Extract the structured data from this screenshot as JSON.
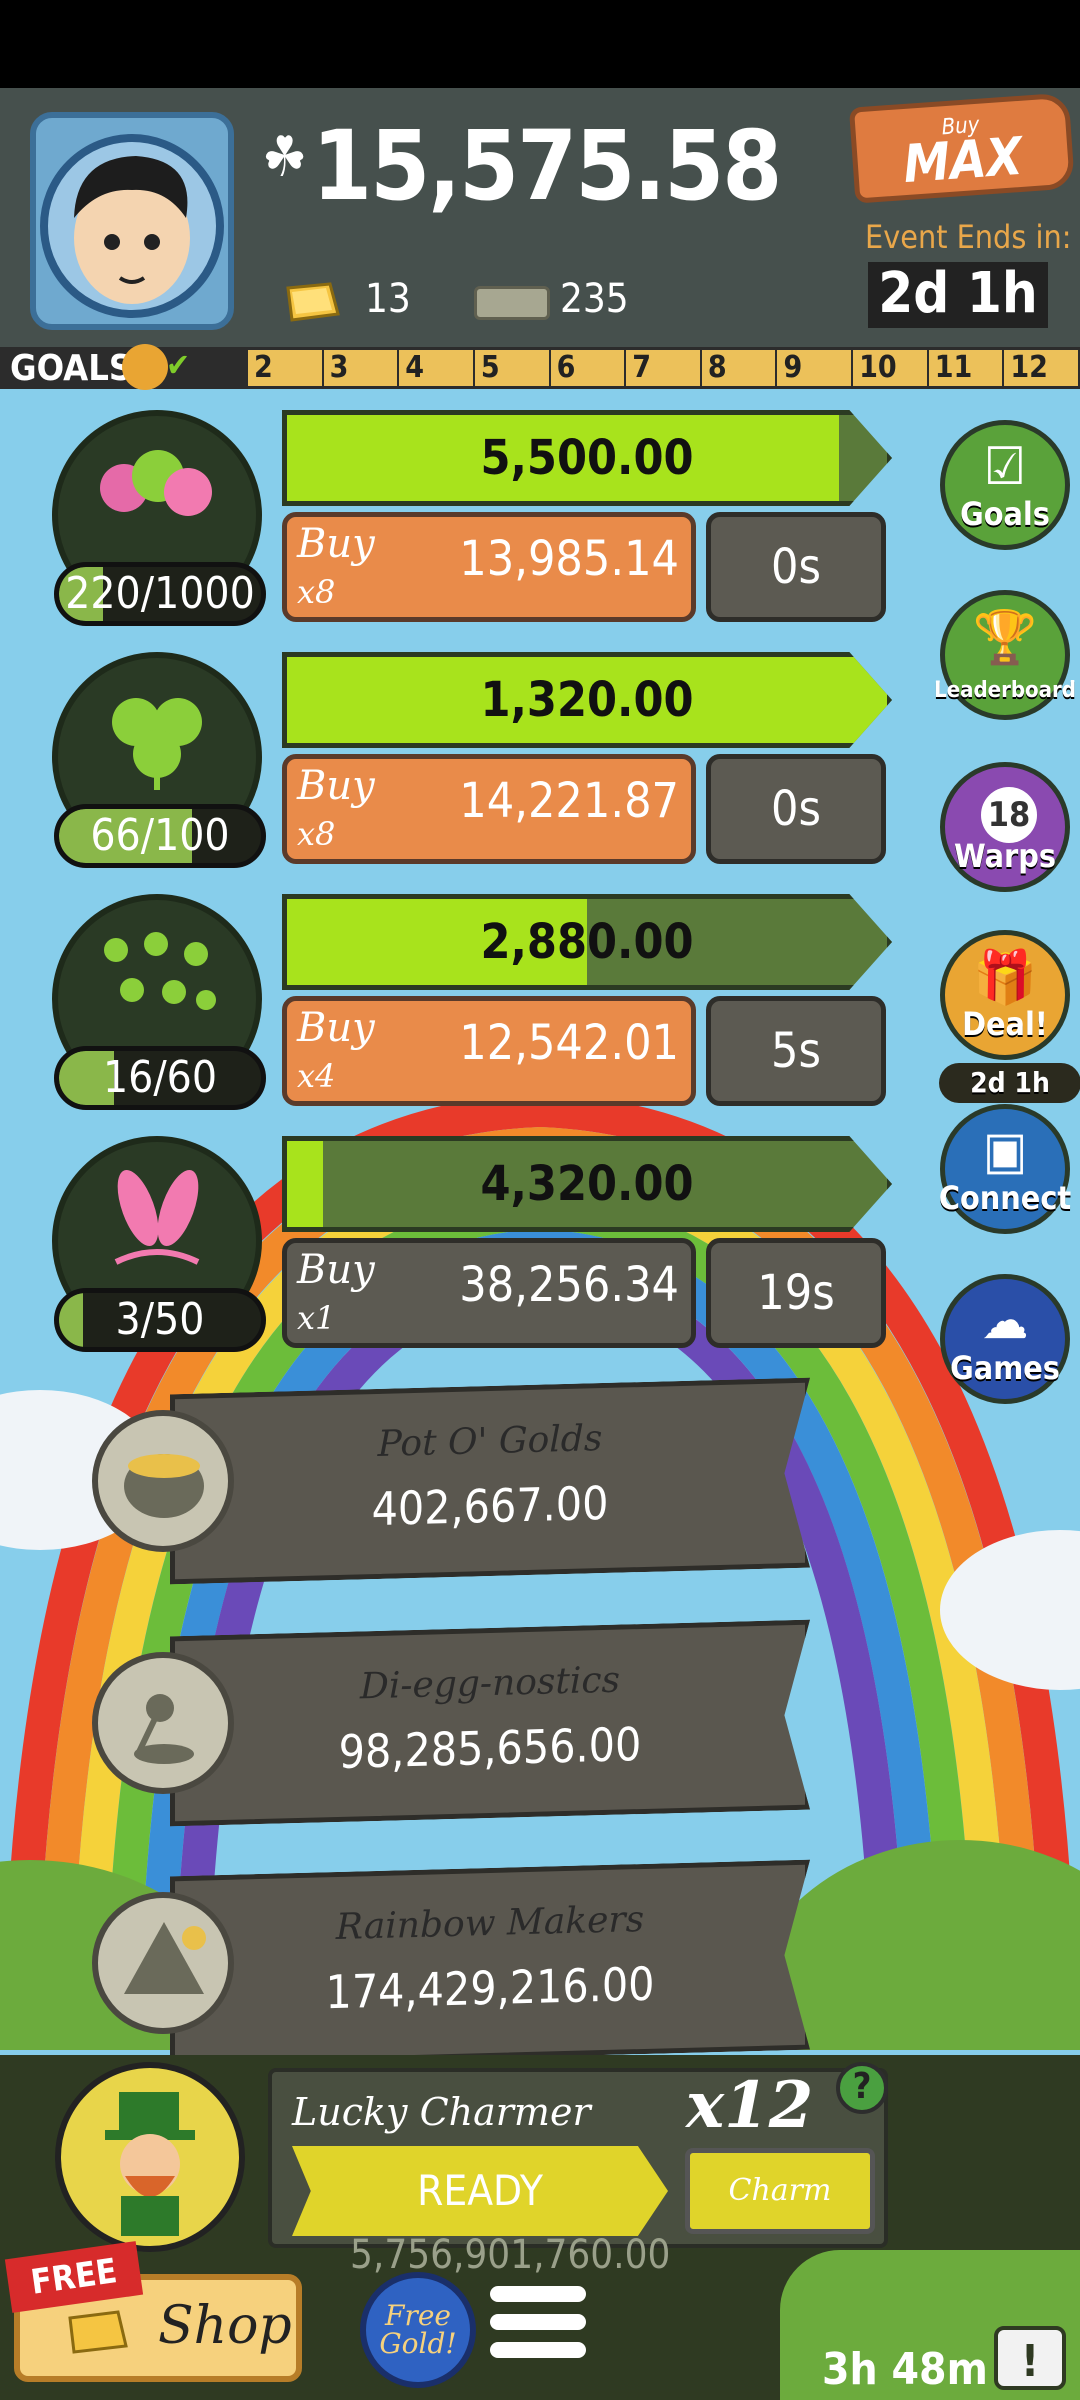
{
  "header": {
    "cash": "15,575.58",
    "gold_count": "13",
    "ticket_count": "235",
    "buy_max": {
      "small": "Buy",
      "big": "MAX"
    },
    "event_label": "Event Ends in:",
    "event_time": "2d 1h"
  },
  "goals": {
    "label": "GOALS",
    "ticks": [
      "2",
      "3",
      "4",
      "5",
      "6",
      "7",
      "8",
      "9",
      "10",
      "11",
      "12"
    ]
  },
  "businesses": [
    {
      "name": "eggs",
      "count": "220/1000",
      "count_fill": 0.22,
      "progress_value": "5,500.00",
      "progress_fill": 0.92,
      "buy_label": "Buy",
      "buy_mult": "x8",
      "buy_price": "13,985.14",
      "timer": "0s",
      "affordable": true
    },
    {
      "name": "clover",
      "count": "66/100",
      "count_fill": 0.66,
      "progress_value": "1,320.00",
      "progress_fill": 1.0,
      "buy_label": "Buy",
      "buy_mult": "x8",
      "buy_price": "14,221.87",
      "timer": "0s",
      "affordable": true
    },
    {
      "name": "clovers",
      "count": "16/60",
      "count_fill": 0.27,
      "progress_value": "2,880.00",
      "progress_fill": 0.5,
      "buy_label": "Buy",
      "buy_mult": "x4",
      "buy_price": "12,542.01",
      "timer": "5s",
      "affordable": true
    },
    {
      "name": "bunny-ears",
      "count": "3/50",
      "count_fill": 0.06,
      "progress_value": "4,320.00",
      "progress_fill": 0.06,
      "buy_label": "Buy",
      "buy_mult": "x1",
      "buy_price": "38,256.34",
      "timer": "19s",
      "affordable": false
    }
  ],
  "side_buttons": [
    {
      "label": "Goals",
      "icon": "checklist-icon",
      "color": "#5aa23a"
    },
    {
      "label": "Leaderboard",
      "icon": "trophy-icon",
      "color": "#5aa23a"
    },
    {
      "label": "Warps",
      "icon": "warp-icon",
      "color": "#8a4ab0",
      "badge": "18"
    },
    {
      "label": "Deal!",
      "icon": "gift-icon",
      "color": "#e9a533",
      "sub": "2d 1h"
    },
    {
      "label": "Connect",
      "icon": "cards-icon",
      "color": "#2a6fb8"
    },
    {
      "label": "Games",
      "icon": "ghost-icon",
      "color": "#2a4fa8"
    }
  ],
  "managers": [
    {
      "name": "Pot O' Golds",
      "price": "402,667.00"
    },
    {
      "name": "Di-egg-nostics",
      "price": "98,285,656.00"
    },
    {
      "name": "Rainbow Makers",
      "price": "174,429,216.00"
    }
  ],
  "bottom": {
    "charmer_name": "Lucky Charmer",
    "charmer_mult": "x12",
    "help": "?",
    "ready_label": "READY",
    "charm_label": "Charm",
    "under_text": "5,756,901,760.00",
    "free_tag": "FREE",
    "shop_label": "Shop",
    "free_gold_label": "Free Gold!",
    "timer": "3h 48m",
    "tv_label": "!"
  }
}
